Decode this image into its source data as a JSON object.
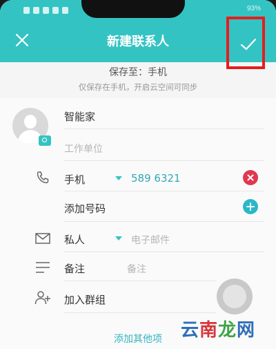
{
  "header": {
    "title": "新建联系人",
    "battery_text": "93%"
  },
  "save": {
    "label": "保存至：手机",
    "hint": "仅保存在手机，开启云空间可同步"
  },
  "contact": {
    "name": "智能家",
    "company_placeholder": "工作单位"
  },
  "phone": {
    "type": "手机",
    "number": "589 6321",
    "add_label": "添加号码"
  },
  "email": {
    "type": "私人",
    "placeholder": "电子邮件"
  },
  "note": {
    "label": "备注",
    "placeholder": "备注"
  },
  "group": {
    "label": "加入群组"
  },
  "footer": {
    "add_more": "添加其他项"
  },
  "watermark": {
    "part1": "云",
    "part2": "南",
    "part3": "龙",
    "part4": "网"
  },
  "colors": {
    "accent": "#34c3c3",
    "delete": "#e0394f",
    "highlight_box": "#e51d1d"
  }
}
